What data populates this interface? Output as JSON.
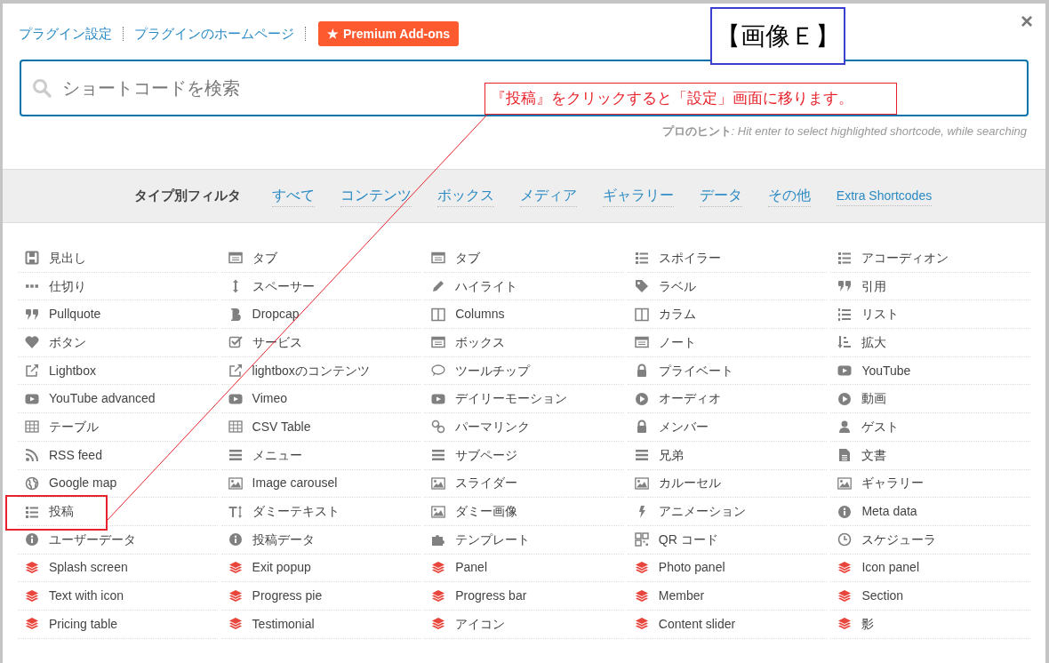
{
  "top_links": [
    {
      "label": "プラグイン設定"
    },
    {
      "label": "プラグインのホームページ"
    }
  ],
  "premium_button": {
    "icon": "★",
    "label": "Premium Add-ons"
  },
  "close": "×",
  "search": {
    "placeholder": "ショートコードを検索"
  },
  "hint": {
    "label": "プロのヒント",
    "text": ": Hit enter to select highlighted shortcode, while searching"
  },
  "filter": {
    "label": "タイプ別フィルタ",
    "options": [
      "すべて",
      "コンテンツ",
      "ボックス",
      "メディア",
      "ギャラリー",
      "データ",
      "その他",
      "Extra Shortcodes"
    ]
  },
  "shortcodes": [
    {
      "label": "見出し",
      "premium": false,
      "highlighted": false
    },
    {
      "label": "タブ",
      "premium": false,
      "highlighted": false
    },
    {
      "label": "タブ",
      "premium": false,
      "highlighted": false
    },
    {
      "label": "スポイラー",
      "premium": false,
      "highlighted": false
    },
    {
      "label": "アコーディオン",
      "premium": false,
      "highlighted": false
    },
    {
      "label": "仕切り",
      "premium": false,
      "highlighted": false
    },
    {
      "label": "スペーサー",
      "premium": false,
      "highlighted": false
    },
    {
      "label": "ハイライト",
      "premium": false,
      "highlighted": false
    },
    {
      "label": "ラベル",
      "premium": false,
      "highlighted": false
    },
    {
      "label": "引用",
      "premium": false,
      "highlighted": false
    },
    {
      "label": "Pullquote",
      "premium": false,
      "highlighted": false
    },
    {
      "label": "Dropcap",
      "premium": false,
      "highlighted": false
    },
    {
      "label": "Columns",
      "premium": false,
      "highlighted": false
    },
    {
      "label": "カラム",
      "premium": false,
      "highlighted": false
    },
    {
      "label": "リスト",
      "premium": false,
      "highlighted": false
    },
    {
      "label": "ボタン",
      "premium": false,
      "highlighted": false
    },
    {
      "label": "サービス",
      "premium": false,
      "highlighted": false
    },
    {
      "label": "ボックス",
      "premium": false,
      "highlighted": false
    },
    {
      "label": "ノート",
      "premium": false,
      "highlighted": false
    },
    {
      "label": "拡大",
      "premium": false,
      "highlighted": false
    },
    {
      "label": "Lightbox",
      "premium": false,
      "highlighted": false
    },
    {
      "label": "lightboxのコンテンツ",
      "premium": false,
      "highlighted": false
    },
    {
      "label": "ツールチップ",
      "premium": false,
      "highlighted": false
    },
    {
      "label": "プライベート",
      "premium": false,
      "highlighted": false
    },
    {
      "label": "YouTube",
      "premium": false,
      "highlighted": false
    },
    {
      "label": "YouTube advanced",
      "premium": false,
      "highlighted": false
    },
    {
      "label": "Vimeo",
      "premium": false,
      "highlighted": false
    },
    {
      "label": "デイリーモーション",
      "premium": false,
      "highlighted": false
    },
    {
      "label": "オーディオ",
      "premium": false,
      "highlighted": false
    },
    {
      "label": "動画",
      "premium": false,
      "highlighted": false
    },
    {
      "label": "テーブル",
      "premium": false,
      "highlighted": false
    },
    {
      "label": "CSV Table",
      "premium": false,
      "highlighted": false
    },
    {
      "label": "パーマリンク",
      "premium": false,
      "highlighted": false
    },
    {
      "label": "メンバー",
      "premium": false,
      "highlighted": false
    },
    {
      "label": "ゲスト",
      "premium": false,
      "highlighted": false
    },
    {
      "label": "RSS feed",
      "premium": false,
      "highlighted": false
    },
    {
      "label": "メニュー",
      "premium": false,
      "highlighted": false
    },
    {
      "label": "サブページ",
      "premium": false,
      "highlighted": false
    },
    {
      "label": "兄弟",
      "premium": false,
      "highlighted": false
    },
    {
      "label": "文書",
      "premium": false,
      "highlighted": false
    },
    {
      "label": "Google map",
      "premium": false,
      "highlighted": false
    },
    {
      "label": "Image carousel",
      "premium": false,
      "highlighted": false
    },
    {
      "label": "スライダー",
      "premium": false,
      "highlighted": false
    },
    {
      "label": "カルーセル",
      "premium": false,
      "highlighted": false
    },
    {
      "label": "ギャラリー",
      "premium": false,
      "highlighted": false
    },
    {
      "label": "投稿",
      "premium": false,
      "highlighted": true
    },
    {
      "label": "ダミーテキスト",
      "premium": false,
      "highlighted": false
    },
    {
      "label": "ダミー画像",
      "premium": false,
      "highlighted": false
    },
    {
      "label": "アニメーション",
      "premium": false,
      "highlighted": false
    },
    {
      "label": "Meta data",
      "premium": false,
      "highlighted": false
    },
    {
      "label": "ユーザーデータ",
      "premium": false,
      "highlighted": false
    },
    {
      "label": "投稿データ",
      "premium": false,
      "highlighted": false
    },
    {
      "label": "テンプレート",
      "premium": false,
      "highlighted": false
    },
    {
      "label": "QR コード",
      "premium": false,
      "highlighted": false
    },
    {
      "label": "スケジューラ",
      "premium": false,
      "highlighted": false
    },
    {
      "label": "Splash screen",
      "premium": true,
      "highlighted": false
    },
    {
      "label": "Exit popup",
      "premium": true,
      "highlighted": false
    },
    {
      "label": "Panel",
      "premium": true,
      "highlighted": false
    },
    {
      "label": "Photo panel",
      "premium": true,
      "highlighted": false
    },
    {
      "label": "Icon panel",
      "premium": true,
      "highlighted": false
    },
    {
      "label": "Text with icon",
      "premium": true,
      "highlighted": false
    },
    {
      "label": "Progress pie",
      "premium": true,
      "highlighted": false
    },
    {
      "label": "Progress bar",
      "premium": true,
      "highlighted": false
    },
    {
      "label": "Member",
      "premium": true,
      "highlighted": false
    },
    {
      "label": "Section",
      "premium": true,
      "highlighted": false
    },
    {
      "label": "Pricing table",
      "premium": true,
      "highlighted": false
    },
    {
      "label": "Testimonial",
      "premium": true,
      "highlighted": false
    },
    {
      "label": "アイコン",
      "premium": true,
      "highlighted": false
    },
    {
      "label": "Content slider",
      "premium": true,
      "highlighted": false
    },
    {
      "label": "影",
      "premium": true,
      "highlighted": false
    }
  ],
  "annotations": {
    "image_label": "【画像Ｅ】",
    "callout": "『投稿』をクリックすると「設定」画面に移ります。"
  }
}
